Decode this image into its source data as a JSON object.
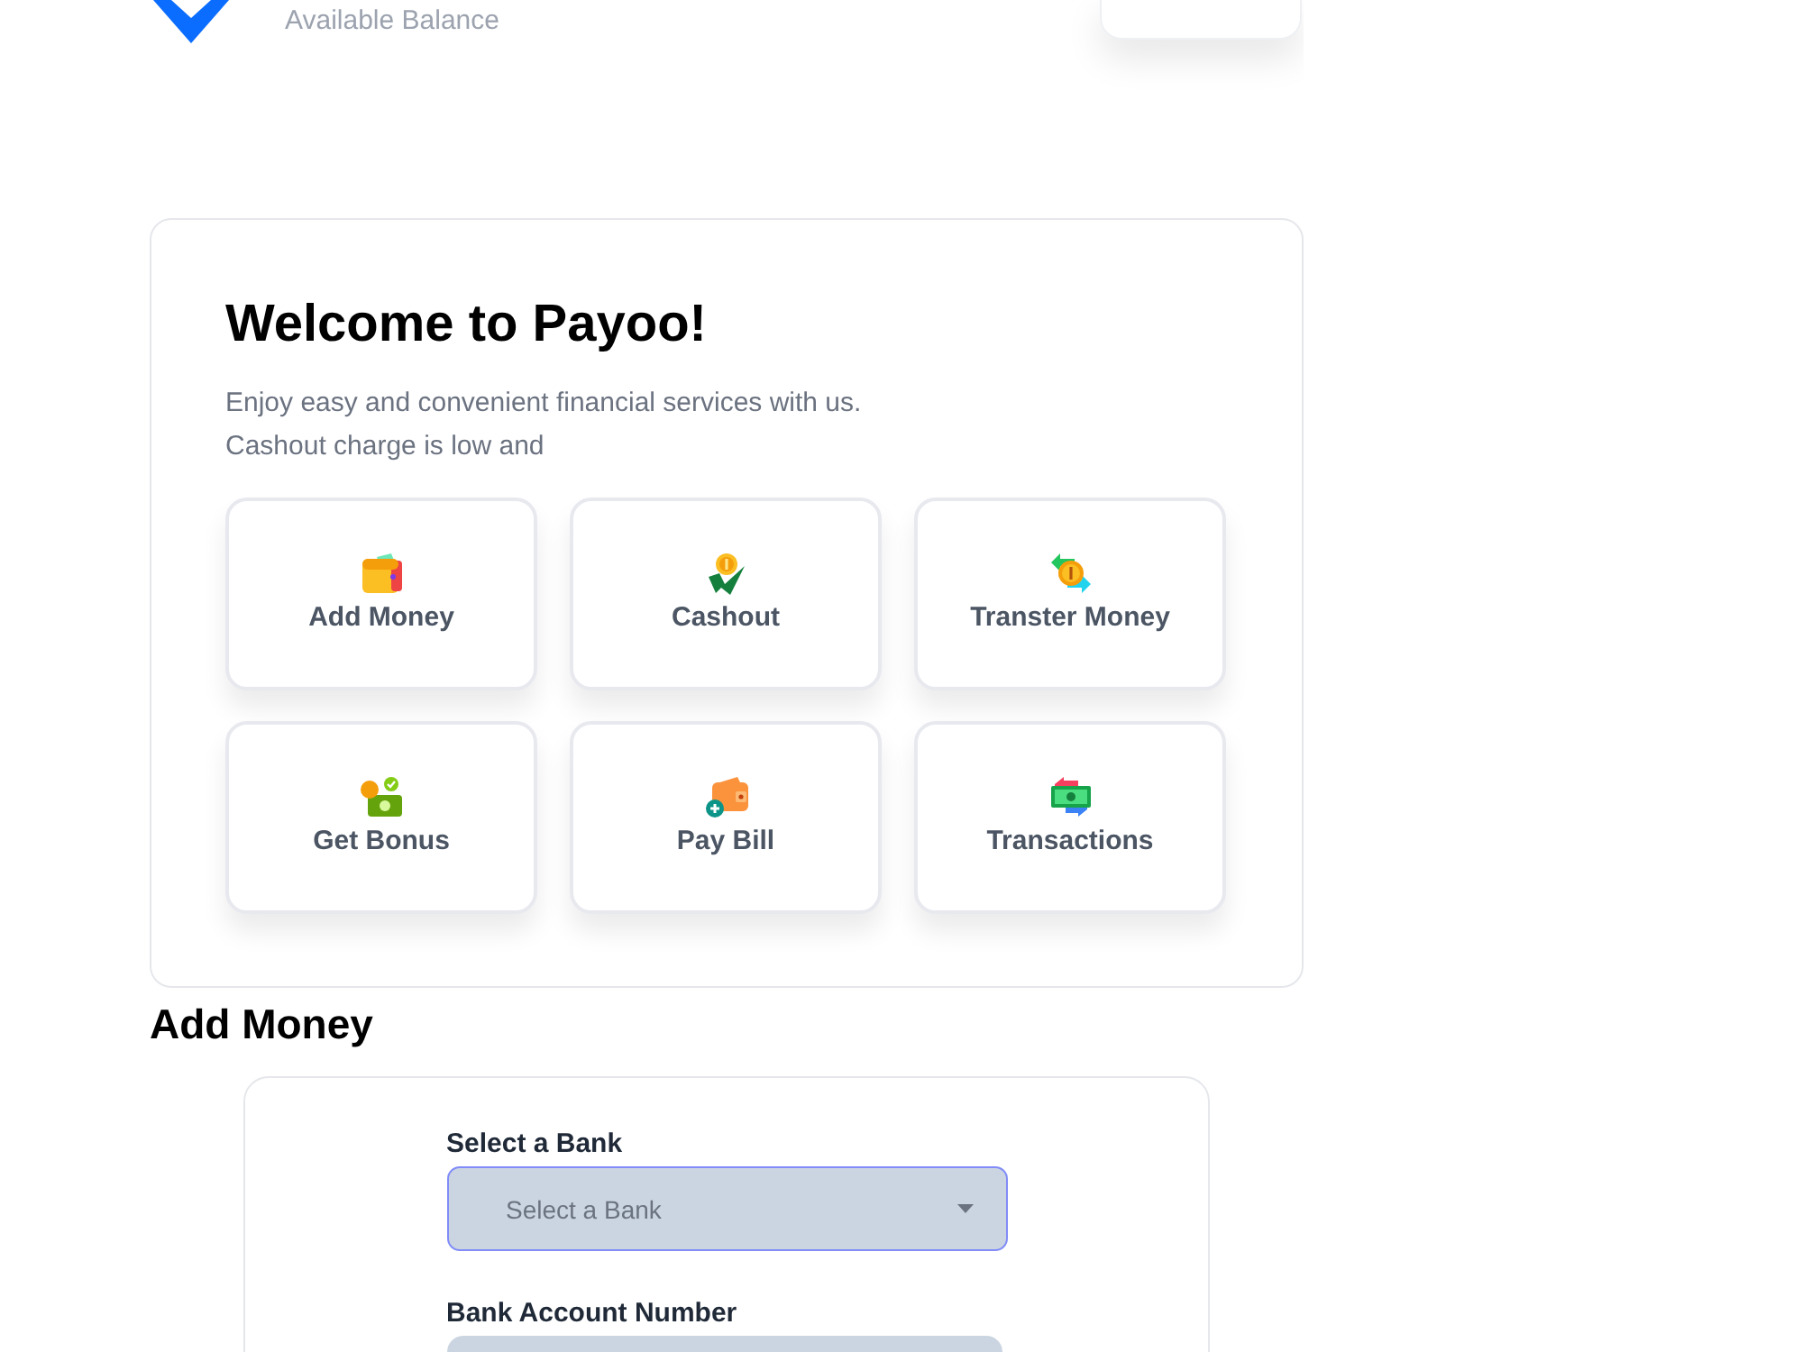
{
  "header": {
    "balance_label": "Available Balance"
  },
  "welcome": {
    "title": "Welcome to Payoo!",
    "description_lines": [
      "Enjoy easy and convenient financial services with us.",
      "Cashout charge is low and"
    ]
  },
  "services": [
    {
      "label": "Add Money",
      "kind": "wallet"
    },
    {
      "label": "Cashout",
      "kind": "cashout"
    },
    {
      "label": "Transter Money",
      "kind": "transfer"
    },
    {
      "label": "Get Bonus",
      "kind": "bonus"
    },
    {
      "label": "Pay Bill",
      "kind": "bill"
    },
    {
      "label": "Transactions",
      "kind": "transactions"
    }
  ],
  "form": {
    "heading": "Add Money",
    "fields": [
      {
        "label": "Select a Bank",
        "kind": "select",
        "placeholder": "Select a Bank"
      },
      {
        "label": "Bank Account Number",
        "kind": "input"
      }
    ]
  }
}
